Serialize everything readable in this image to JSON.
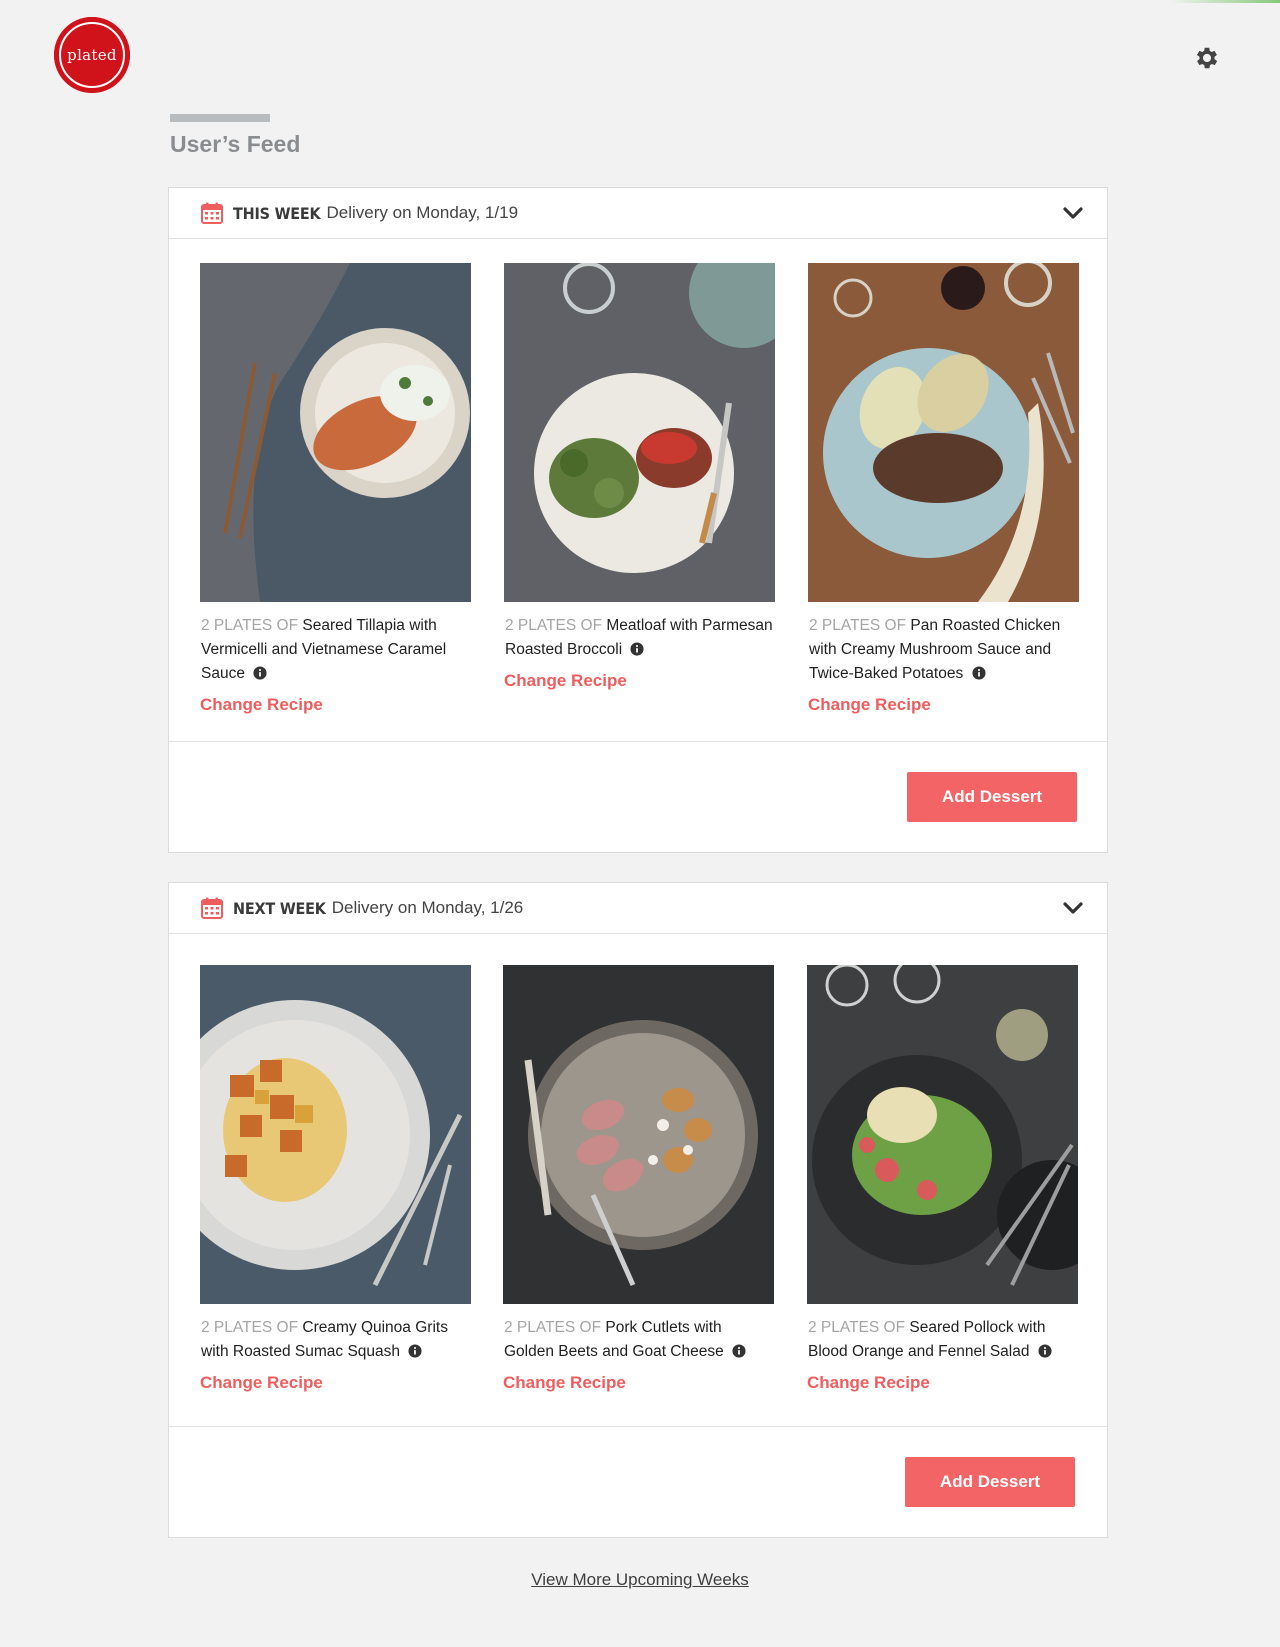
{
  "brand": {
    "logo_text": "plated"
  },
  "header": {
    "settings_icon": "gear-icon"
  },
  "feed": {
    "title": "User’s Feed"
  },
  "weeks": [
    {
      "label": "THIS WEEK",
      "delivery": "Delivery on Monday, 1/19",
      "recipes": [
        {
          "plates": "2 PLATES OF",
          "name": "Seared Tillapia with Vermicelli and Vietnamese Caramel Sauce",
          "action": "Change Recipe",
          "palette": [
            "#4b5866",
            "#d9d3c8",
            "#c96a3c"
          ]
        },
        {
          "plates": "2 PLATES OF",
          "name": "Meatloaf with Parmesan Roasted Broccoli",
          "action": "Change Recipe",
          "palette": [
            "#5f6166",
            "#ece9e3",
            "#5e7a3a"
          ]
        },
        {
          "plates": "2 PLATES OF",
          "name": "Pan Roasted Chicken with Creamy Mushroom Sauce and Twice-Baked Potatoes",
          "action": "Change Recipe",
          "palette": [
            "#8a5a3a",
            "#a9c6cc",
            "#d9cfa0"
          ]
        }
      ],
      "dessert_button": "Add Dessert"
    },
    {
      "label": "NEXT WEEK",
      "delivery": "Delivery on Monday, 1/26",
      "recipes": [
        {
          "plates": "2 PLATES OF",
          "name": "Creamy Quinoa Grits with Roasted Sumac Squash",
          "action": "Change Recipe",
          "palette": [
            "#4a5a68",
            "#d8d8d6",
            "#d9a13a"
          ]
        },
        {
          "plates": "2 PLATES OF",
          "name": "Pork Cutlets with Golden Beets and Goat Cheese",
          "action": "Change Recipe",
          "palette": [
            "#2f3133",
            "#9c968c",
            "#c78b4a"
          ]
        },
        {
          "plates": "2 PLATES OF",
          "name": "Seared Pollock with Blood Orange and Fennel Salad",
          "action": "Change Recipe",
          "palette": [
            "#3e3f41",
            "#2b2c2e",
            "#6ea046"
          ]
        }
      ],
      "dessert_button": "Add Dessert"
    }
  ],
  "footer": {
    "view_more": "View More Upcoming Weeks"
  },
  "colors": {
    "brand_red": "#d0121b",
    "accent_coral": "#f26466",
    "link_coral": "#ee5e5e"
  }
}
